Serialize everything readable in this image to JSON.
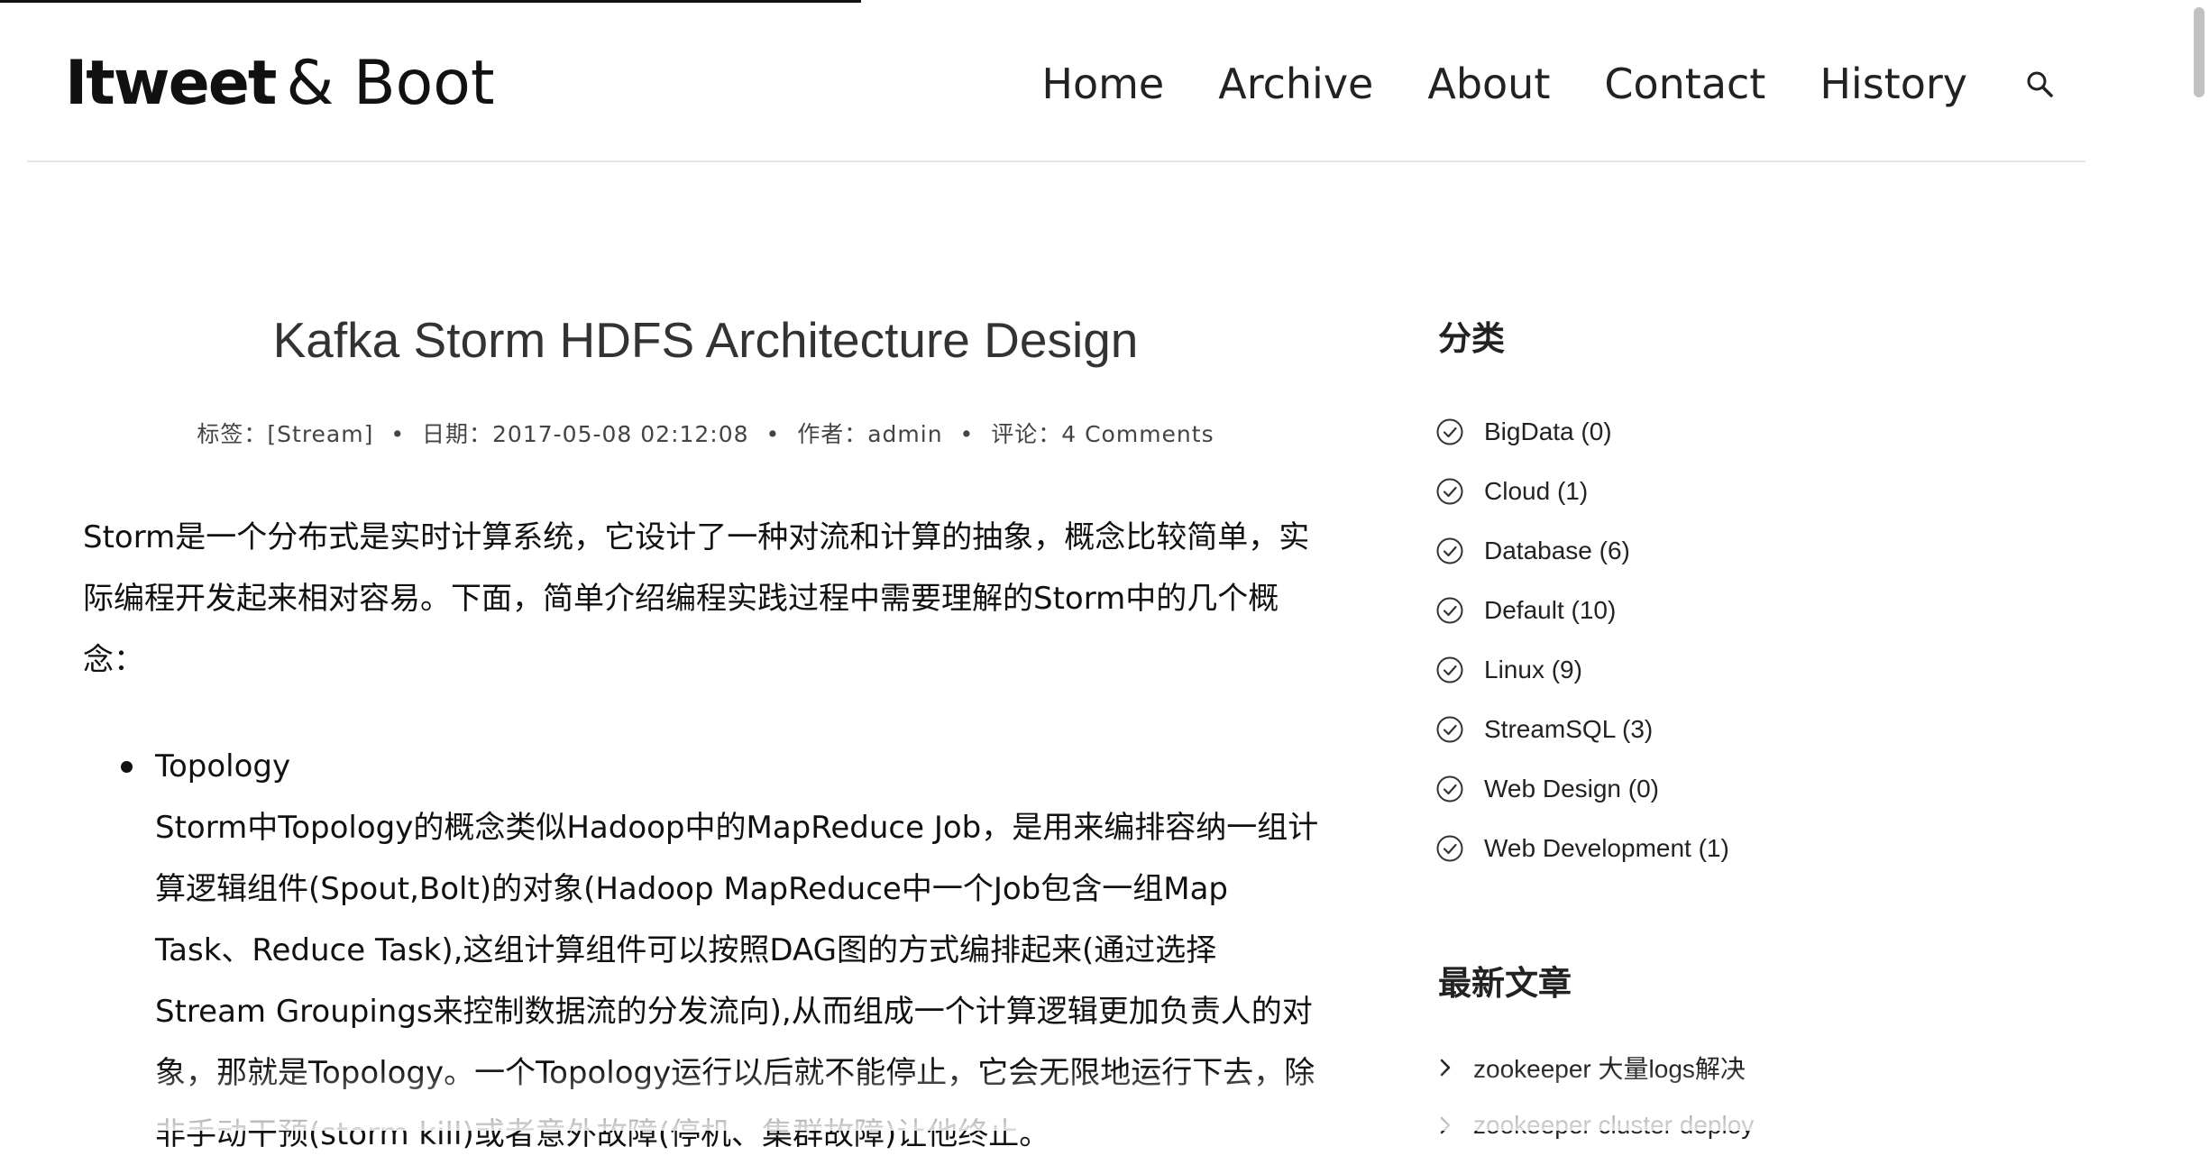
{
  "header": {
    "brand_main": "Itweet",
    "brand_rest": "& Boot",
    "nav": [
      "Home",
      "Archive",
      "About",
      "Contact",
      "History"
    ],
    "search_icon": "search-icon"
  },
  "post": {
    "title": "Kafka Storm HDFS Architecture Design",
    "meta": {
      "tags_label": "标签：",
      "tags_value": "[Stream]",
      "date_label": "日期：",
      "date_value": "2017-05-08 02:12:08",
      "author_label": "作者：",
      "author_value": "admin",
      "comments_label": "评论：",
      "comments_value": "4 Comments",
      "separator": "•"
    },
    "intro": "Storm是一个分布式是实时计算系统，它设计了一种对流和计算的抽象，概念比较简单，实际编程开发起来相对容易。下面，简单介绍编程实践过程中需要理解的Storm中的几个概念：",
    "concepts": [
      {
        "name": "Topology",
        "description": "Storm中Topology的概念类似Hadoop中的MapReduce Job，是用来编排容纳一组计算逻辑组件(Spout,Bolt)的对象(Hadoop MapReduce中一个Job包含一组Map Task、Reduce Task),这组计算组件可以按照DAG图的方式编排起来(通过选择Stream Groupings来控制数据流的分发流向),从而组成一个计算逻辑更加负责人的对象，那就是Topology。一个Topology运行以后就不能停止，它会无限地运行下去，除非手动干预(storm kill)或者意外故障(停机、集群故障)让他终止。"
      }
    ]
  },
  "sidebar": {
    "categories_title": "分类",
    "categories": [
      "BigData (0)",
      "Cloud (1)",
      "Database (6)",
      "Default (10)",
      "Linux (9)",
      "StreamSQL (3)",
      "Web Design (0)",
      "Web Development (1)"
    ],
    "category_icon": "check-circle-icon",
    "recent_title": "最新文章",
    "recent": [
      "zookeeper 大量logs解决",
      "zookeeper cluster deploy"
    ],
    "recent_icon": "chevron-right-icon"
  },
  "colors": {
    "text": "#222222",
    "rule": "#e6e6e6",
    "progress": "#111111"
  }
}
